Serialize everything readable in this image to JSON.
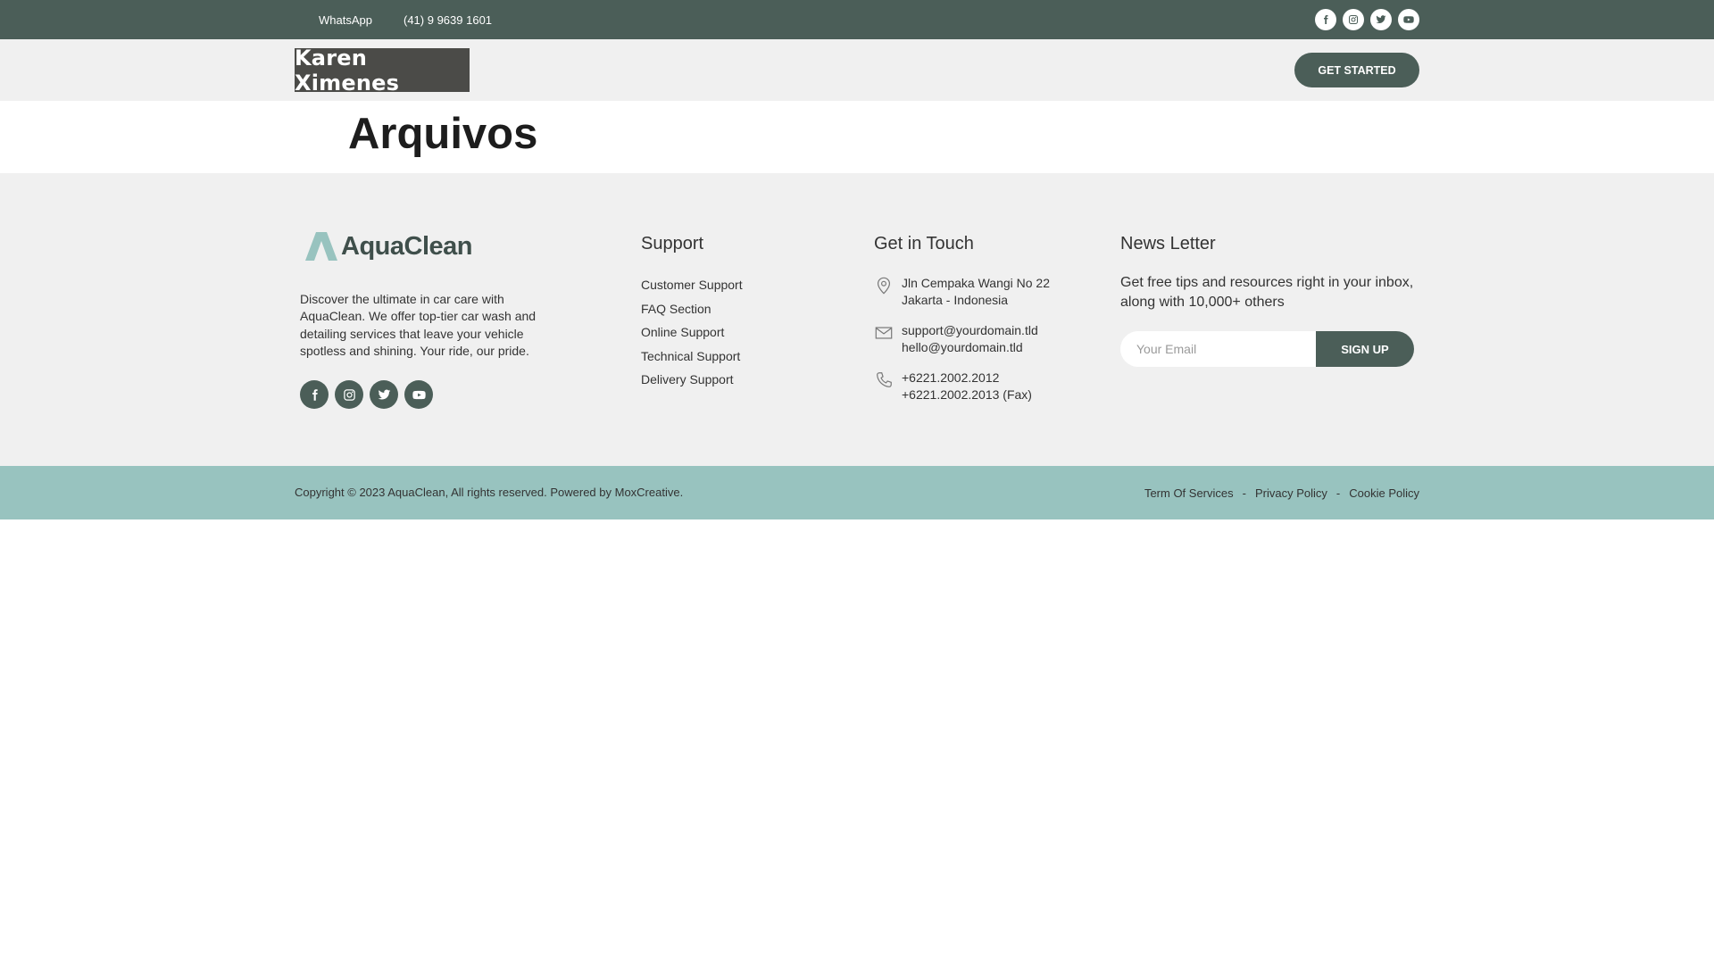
{
  "topbar": {
    "whatsapp_label": "WhatsApp",
    "phone": "(41) 9 9639 1601",
    "background_color": "#4b5e58",
    "socials": [
      "facebook-icon",
      "instagram-icon",
      "twitter-icon",
      "youtube-icon"
    ]
  },
  "header": {
    "logo_text": "Karen Ximenes",
    "cta_label": "GET STARTED"
  },
  "page": {
    "title": "Arquivos"
  },
  "footer": {
    "brand": "AquaClean",
    "brand_color": "#98c3bf",
    "about": "Discover the ultimate in car care with AquaClean. We offer top-tier car wash and detailing services that leave your vehicle spotless and shining. Your ride, our pride.",
    "socials": [
      "facebook-icon",
      "instagram-icon",
      "twitter-icon",
      "youtube-icon"
    ],
    "support": {
      "title": "Support",
      "items": [
        "Customer Support",
        "FAQ Section",
        "Online Support",
        "Technical Support",
        "Delivery Support"
      ]
    },
    "contact": {
      "title": "Get in Touch",
      "address_line1": "Jln Cempaka Wangi No 22",
      "address_line2": "Jakarta - Indonesia",
      "email1": "support@yourdomain.tld",
      "email2": "hello@yourdomain.tld",
      "phone1": "+6221.2002.2012",
      "phone2": "+6221.2002.2013 (Fax)"
    },
    "newsletter": {
      "title": "News Letter",
      "text": "Get free tips and resources right in your inbox, along with 10,000+ others",
      "placeholder": "Your Email",
      "button_label": "SIGN UP"
    }
  },
  "bottom": {
    "copyright": "Copyright © 2023 AquaClean, All rights reserved. Powered by MoxCreative.",
    "links": [
      "Term Of Services",
      "Privacy Policy",
      "Cookie Policy"
    ],
    "separator": "-",
    "background_color": "#98c3bf"
  }
}
